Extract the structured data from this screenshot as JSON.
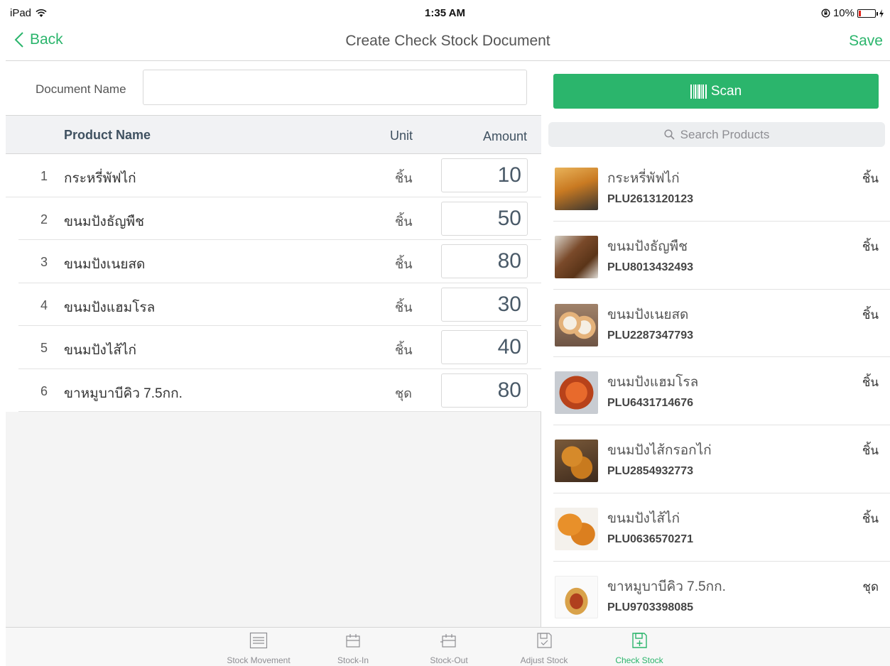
{
  "status_bar": {
    "device": "iPad",
    "time": "1:35 AM",
    "battery": "10%"
  },
  "nav": {
    "back": "Back",
    "title": "Create Check Stock Document",
    "save": "Save"
  },
  "document": {
    "label": "Document Name",
    "value": ""
  },
  "table": {
    "headers": {
      "name": "Product Name",
      "unit": "Unit",
      "amount": "Amount"
    },
    "rows": [
      {
        "num": "1",
        "name": "กระหรี่พัฟไก่",
        "unit": "ชิ้น",
        "amount": "10"
      },
      {
        "num": "2",
        "name": "ขนมปังธัญพืช",
        "unit": "ชิ้น",
        "amount": "50"
      },
      {
        "num": "3",
        "name": "ขนมปังเนยสด",
        "unit": "ชิ้น",
        "amount": "80"
      },
      {
        "num": "4",
        "name": "ขนมปังแฮมโรล",
        "unit": "ชิ้น",
        "amount": "30"
      },
      {
        "num": "5",
        "name": "ขนมปังไส้ไก่",
        "unit": "ชิ้น",
        "amount": "40"
      },
      {
        "num": "6",
        "name": "ขาหมูบาบีคิว 7.5กก.",
        "unit": "ชุด",
        "amount": "80"
      }
    ]
  },
  "scan": {
    "label": "Scan",
    "icon": "barcode-icon"
  },
  "search": {
    "placeholder": "Search Products",
    "icon": "search-icon"
  },
  "products": [
    {
      "name": "กระหรี่พัฟไก่",
      "plu": "PLU2613120123",
      "unit": "ชิ้น"
    },
    {
      "name": "ขนมปังธัญพืช",
      "plu": "PLU8013432493",
      "unit": "ชิ้น"
    },
    {
      "name": "ขนมปังเนยสด",
      "plu": "PLU2287347793",
      "unit": "ชิ้น"
    },
    {
      "name": "ขนมปังแฮมโรล",
      "plu": "PLU6431714676",
      "unit": "ชิ้น"
    },
    {
      "name": "ขนมปังไส้กรอกไก่",
      "plu": "PLU2854932773",
      "unit": "ชิ้น"
    },
    {
      "name": "ขนมปังไส้ไก่",
      "plu": "PLU0636570271",
      "unit": "ชิ้น"
    },
    {
      "name": "ขาหมูบาบีคิว 7.5กก.",
      "plu": "PLU9703398085",
      "unit": "ชุด"
    }
  ],
  "tabs": [
    {
      "label": "Stock Movement",
      "icon": "list-icon",
      "active": false
    },
    {
      "label": "Stock-In",
      "icon": "box-in-icon",
      "active": false
    },
    {
      "label": "Stock-Out",
      "icon": "box-out-icon",
      "active": false
    },
    {
      "label": "Adjust Stock",
      "icon": "adjust-doc-icon",
      "active": false
    },
    {
      "label": "Check Stock",
      "icon": "check-doc-icon",
      "active": true
    }
  ],
  "colors": {
    "accent": "#2bb56c",
    "text": "#333333",
    "muted": "#8e8e93"
  }
}
